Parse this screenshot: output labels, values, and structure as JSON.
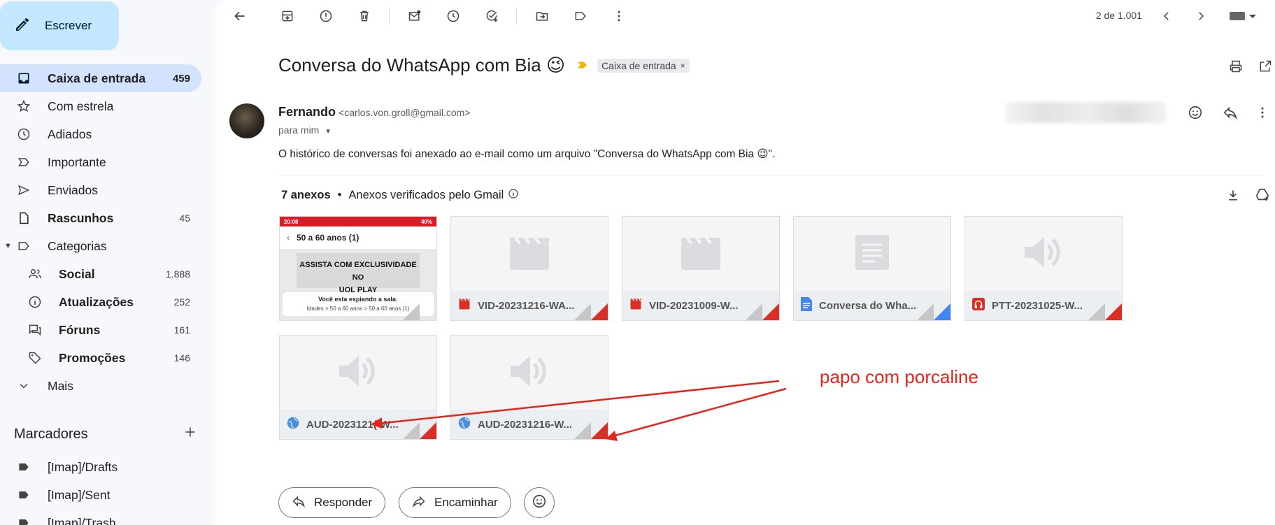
{
  "compose": {
    "label": "Escrever"
  },
  "nav": [
    {
      "label": "Caixa de entrada",
      "count": "459",
      "icon": "inbox-icon"
    },
    {
      "label": "Com estrela",
      "count": "",
      "icon": "star-icon"
    },
    {
      "label": "Adiados",
      "count": "",
      "icon": "clock-icon"
    },
    {
      "label": "Importante",
      "count": "",
      "icon": "important-icon"
    },
    {
      "label": "Enviados",
      "count": "",
      "icon": "send-icon"
    },
    {
      "label": "Rascunhos",
      "count": "45",
      "icon": "draft-icon"
    },
    {
      "label": "Categorias",
      "count": "",
      "icon": "label-icon"
    },
    {
      "label": "Social",
      "count": "1.888",
      "icon": "people-icon"
    },
    {
      "label": "Atualizações",
      "count": "252",
      "icon": "info-icon"
    },
    {
      "label": "Fóruns",
      "count": "161",
      "icon": "forum-icon"
    },
    {
      "label": "Promoções",
      "count": "146",
      "icon": "tag-icon"
    },
    {
      "label": "Mais",
      "count": "",
      "icon": "chevron-down-icon"
    }
  ],
  "labels": {
    "heading": "Marcadores",
    "items": [
      "[Imap]/Drafts",
      "[Imap]/Sent",
      "[Imap]/Trash"
    ]
  },
  "pager": {
    "text": "2 de 1.001"
  },
  "email": {
    "subject": "Conversa do WhatsApp com Bia 😉",
    "inbox_chip": "Caixa de entrada",
    "sender_name": "Fernando",
    "sender_email": "<carlos.von.groll@gmail.com>",
    "to": "para mim",
    "body": "O histórico de conversas foi anexado ao e-mail como um arquivo \"Conversa do WhatsApp com Bia 😉\"."
  },
  "attachments": {
    "count_label": "7 anexos",
    "verified_label": "Anexos verificados pelo Gmail",
    "items": [
      {
        "name": "",
        "type": "image"
      },
      {
        "name": "VID-20231216-WA...",
        "type": "video"
      },
      {
        "name": "VID-20231009-W...",
        "type": "video"
      },
      {
        "name": "Conversa do Wha...",
        "type": "doc"
      },
      {
        "name": "PTT-20231025-W...",
        "type": "audio"
      },
      {
        "name": "AUD-2023121(-W...",
        "type": "audio"
      },
      {
        "name": "AUD-20231216-W...",
        "type": "audio"
      }
    ],
    "thumb": {
      "status_time": "20:08",
      "status_right": "40%",
      "title": "50 a 60 anos (1)",
      "banner_line1": "ASSISTA COM EXCLUSIVIDADE NO",
      "banner_line2": "UOL PLAY",
      "wait_text": "Você esta espiando a sala:",
      "crumbs": "Idades > 50 a 60 anos > 50 a 60 anos (1)"
    }
  },
  "annotation": {
    "text": "papo com porcaline",
    "color": "#e8231a"
  },
  "actions": {
    "reply": "Responder",
    "forward": "Encaminhar"
  },
  "colors": {
    "accent": "#c2e7ff",
    "active_nav": "#d3e3fd",
    "arrow": "#e8231a"
  }
}
